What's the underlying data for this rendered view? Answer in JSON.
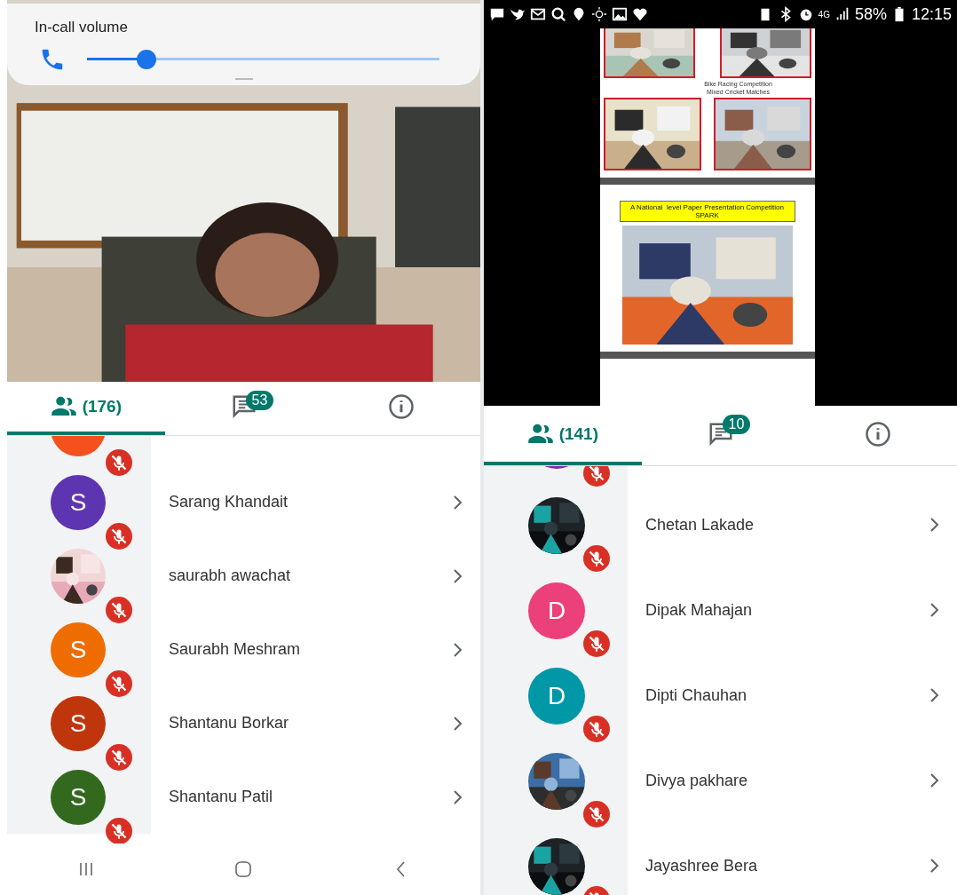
{
  "left": {
    "volume": {
      "title": "In-call volume",
      "level": 0.17
    },
    "tabs": [
      {
        "kind": "people",
        "label": "(176)",
        "selected": true
      },
      {
        "kind": "chat",
        "badge": "53",
        "selected": false
      },
      {
        "kind": "info",
        "selected": false
      }
    ],
    "participants": [
      {
        "kind": "letter",
        "color": "#f4511e",
        "muted": true
      },
      {
        "kind": "letter",
        "letter": "S",
        "color": "#5e35b1",
        "name": "Sarang Khandait",
        "muted": true
      },
      {
        "name": "saurabh awachat",
        "muted": true
      },
      {
        "kind": "letter",
        "letter": "S",
        "color": "#ef6c00",
        "name": "Saurabh Meshram",
        "muted": true
      },
      {
        "kind": "letter",
        "letter": "S",
        "color": "#bf360c",
        "name": "Shantanu Borkar",
        "muted": true
      },
      {
        "kind": "letter",
        "letter": "S",
        "color": "#33691e",
        "name": "Shantanu Patil",
        "muted": true
      }
    ]
  },
  "right": {
    "status_bar": {
      "network": "4G",
      "battery": "58%",
      "time": "12:15"
    },
    "slide": {
      "captions": [
        "Bike Racing Competition",
        "Mixed Cricket Matches"
      ],
      "banner": [
        "A National  level Paper Presentation Competition",
        "SPARK"
      ]
    },
    "tabs": [
      {
        "kind": "people",
        "label": "(141)",
        "selected": true
      },
      {
        "kind": "chat",
        "badge": "10",
        "selected": false
      },
      {
        "kind": "info",
        "selected": false
      }
    ],
    "participants": [
      {
        "kind": "letter",
        "color": "#8e24aa",
        "muted": true
      },
      {
        "name": "Chetan Lakade",
        "muted": true
      },
      {
        "kind": "letter",
        "letter": "D",
        "color": "#ec407a",
        "name": "Dipak Mahajan",
        "muted": true
      },
      {
        "kind": "letter",
        "letter": "D",
        "color": "#0097a7",
        "name": "Dipti Chauhan",
        "muted": true
      },
      {
        "name": "Divya pakhare",
        "muted": true
      },
      {
        "name": "Jayashree Bera",
        "muted": true
      }
    ]
  }
}
